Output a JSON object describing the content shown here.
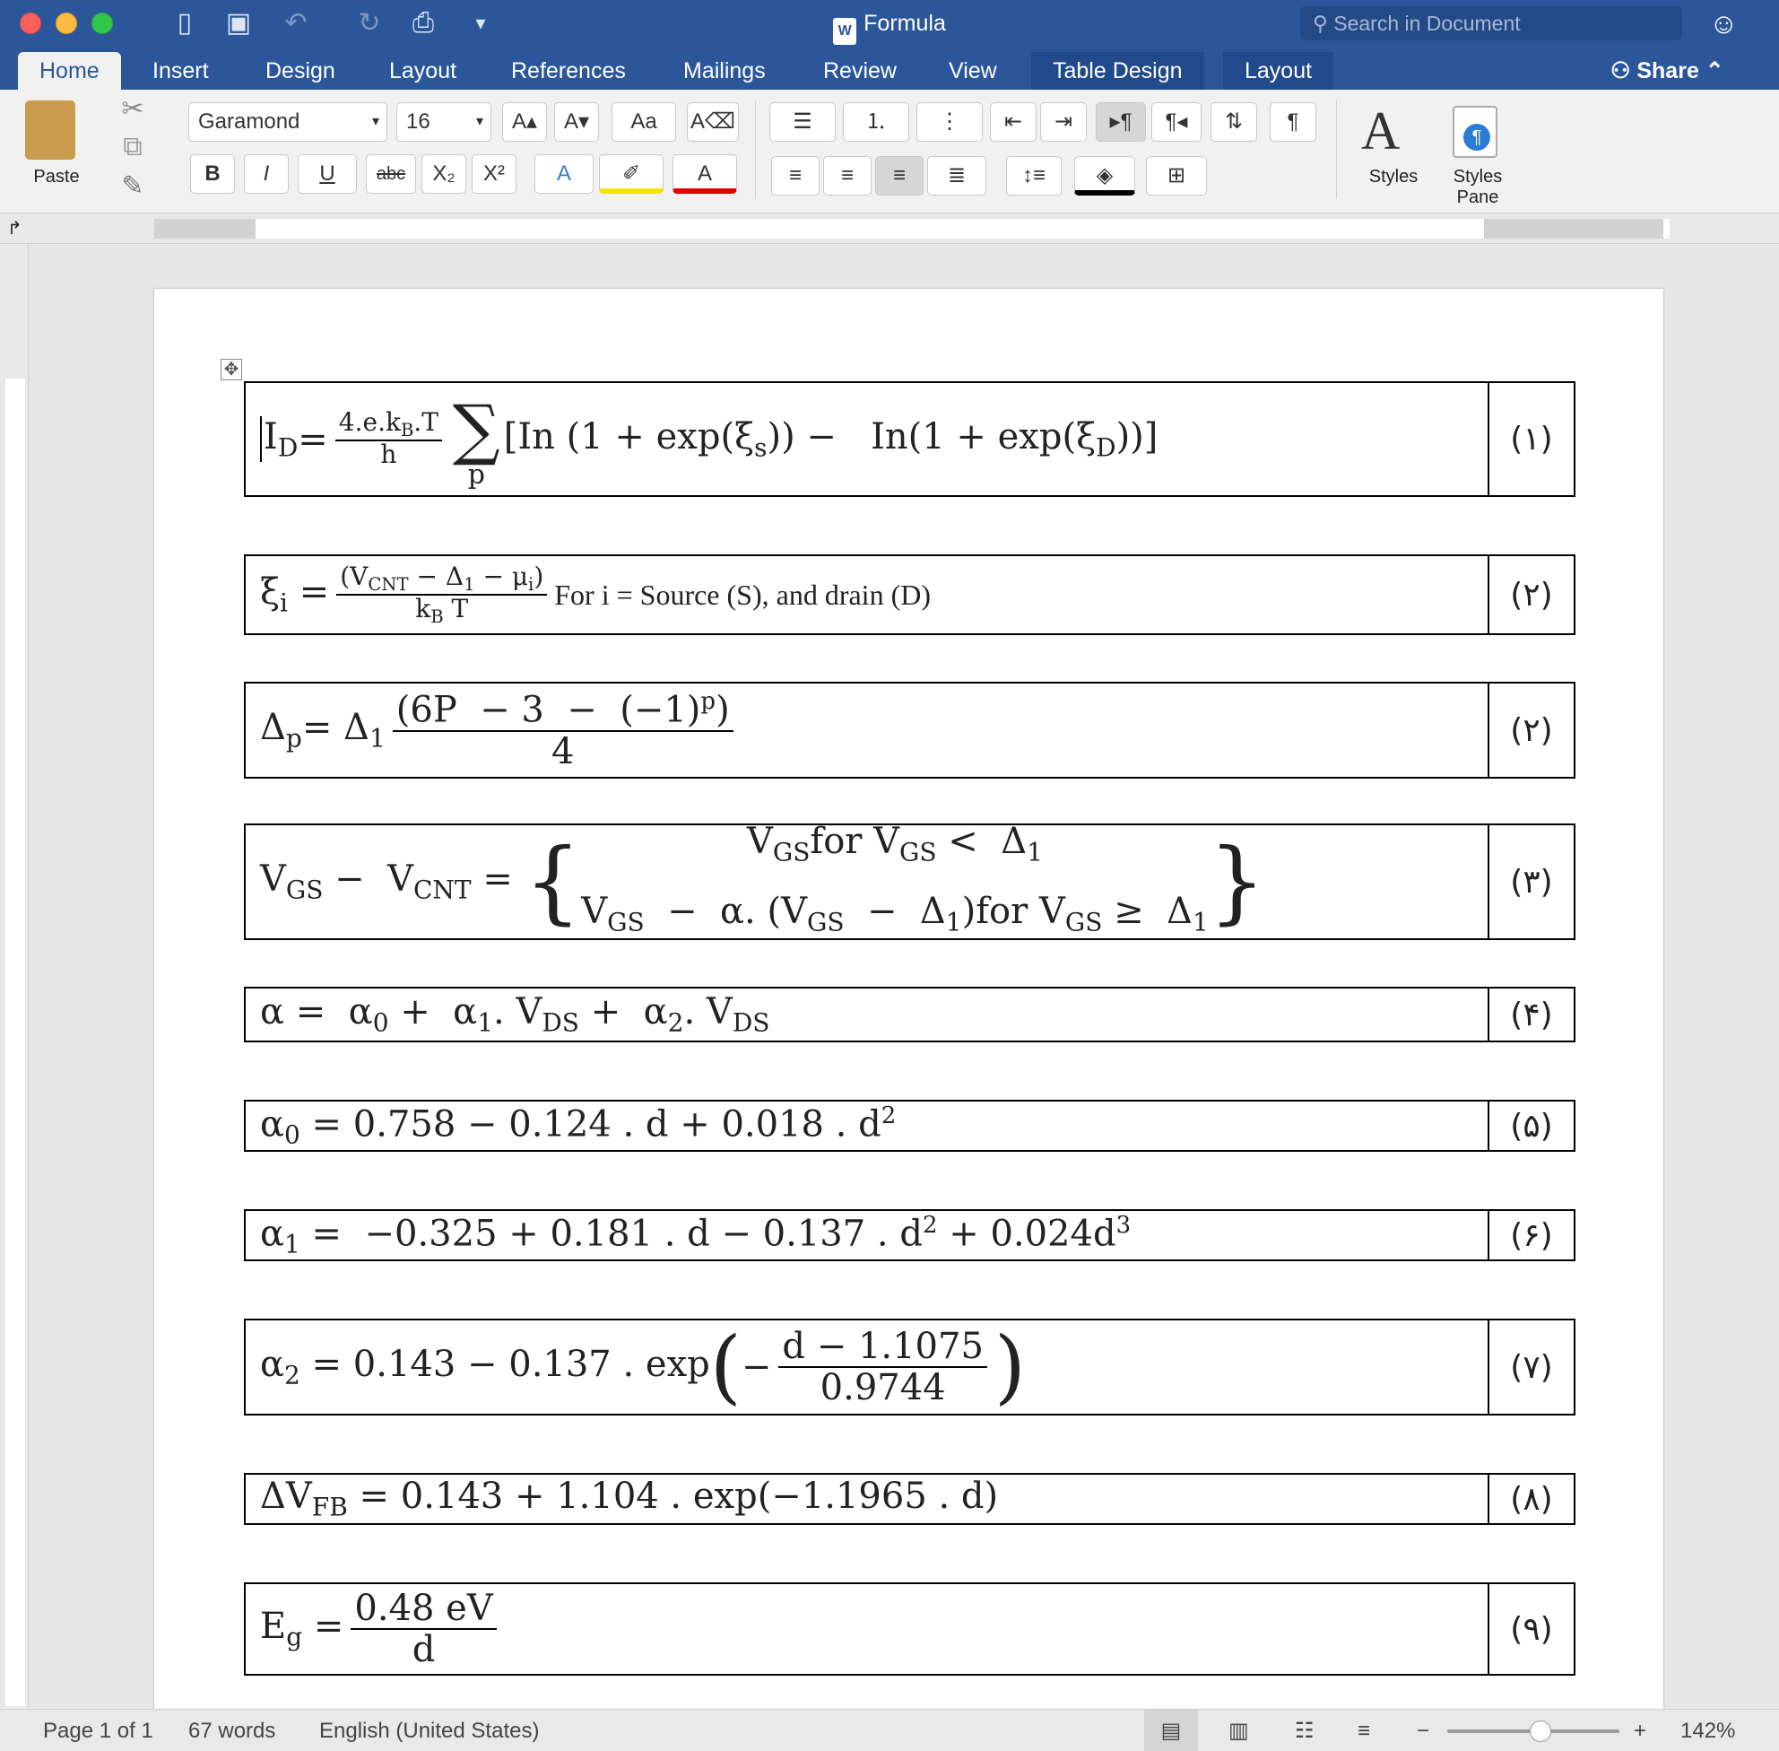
{
  "window": {
    "title": "Formula",
    "search_placeholder": "Search in Document"
  },
  "tabs": [
    "Home",
    "Insert",
    "Design",
    "Layout",
    "References",
    "Mailings",
    "Review",
    "View",
    "Table Design",
    "Layout"
  ],
  "share_label": "Share",
  "ribbon": {
    "paste_label": "Paste",
    "font_name": "Garamond",
    "font_size": "16",
    "styles_label": "Styles",
    "styles_pane_label": "Styles Pane"
  },
  "equations": [
    {
      "num": "(۱)"
    },
    {
      "num": "(۲)",
      "text_for": "For   i = Source (S), and drain (D)"
    },
    {
      "num": "(۲)"
    },
    {
      "num": "(۳)"
    },
    {
      "num": "(۴)"
    },
    {
      "num": "(۵)"
    },
    {
      "num": "(۶)"
    },
    {
      "num": "(۷)"
    },
    {
      "num": "(۸)"
    },
    {
      "num": "(۹)"
    }
  ],
  "status": {
    "page": "Page 1 of 1",
    "words": "67 words",
    "language": "English (United States)",
    "zoom": "142%"
  }
}
